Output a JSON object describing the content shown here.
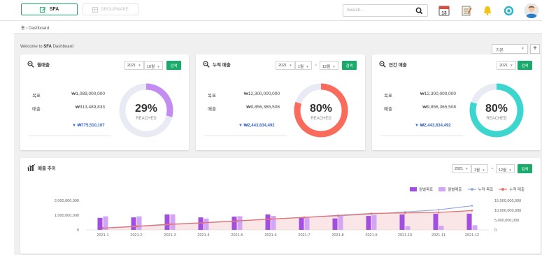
{
  "header": {
    "tab_sfa": "SFA",
    "tab_groupware": "GROUPWARE",
    "search_placeholder": "Search...",
    "calendar_day": "13",
    "breadcrumb": "Dashboard"
  },
  "welcome": {
    "prefix": "Welcome to ",
    "strong": "SFA",
    "suffix": " Dashboard"
  },
  "layout_select": "기본",
  "cards": [
    {
      "title": "월매출",
      "year": "2021",
      "month": "10월",
      "btn": "검색",
      "target_label": "목표",
      "target": "₩1,089,000,000",
      "sales_label": "매출",
      "sales": "₩313,489,833",
      "diff": "₩775,510,167",
      "percent": "29%",
      "reached": "REACHED",
      "progress": 0.29,
      "color": "#c28cf0"
    },
    {
      "title": "누적 매출",
      "year": "2021",
      "from": "1월",
      "to": "12월",
      "btn": "검색",
      "target_label": "목표",
      "target": "₩12,300,000,000",
      "sales_label": "매출",
      "sales": "₩9,856,365,508",
      "diff": "₩2,443,634,492",
      "percent": "80%",
      "reached": "REACHED",
      "progress": 0.8,
      "color": "#fa6b5b"
    },
    {
      "title": "연간 매출",
      "year": "2021",
      "btn": "검색",
      "target_label": "목표",
      "target": "₩12,300,000,000",
      "sales_label": "매출",
      "sales": "₩9,856,365,508",
      "diff": "₩2,443,634,492",
      "percent": "80%",
      "reached": "REACHED",
      "progress": 0.8,
      "color": "#3dd6cf"
    }
  ],
  "trend": {
    "title": "매출 추이",
    "year": "2021",
    "from": "1월",
    "to": "12월",
    "btn": "검색"
  },
  "colors": {
    "accent": "#1aab6c",
    "link": "#3d66cf",
    "bg": "#f0f0f0"
  },
  "chart_data": {
    "type": "bar",
    "categories": [
      "2021-1",
      "2021-2",
      "2021-3",
      "2021-4",
      "2021-5",
      "2021-6",
      "2021-7",
      "2021-8",
      "2021-9",
      "2021-10",
      "2021-11",
      "2021-12"
    ],
    "series": [
      {
        "name": "월별목표",
        "type": "bar",
        "axis": "left",
        "color": "#a24fe0",
        "values": [
          820000000,
          850000000,
          1050000000,
          850000000,
          900000000,
          1050000000,
          850000000,
          780000000,
          950000000,
          1050000000,
          1100000000,
          1100000000
        ]
      },
      {
        "name": "월별매출",
        "type": "bar",
        "axis": "left",
        "color": "#d2a6f5",
        "values": [
          920000000,
          920000000,
          1050000000,
          770000000,
          930000000,
          950000000,
          850000000,
          1000000000,
          1000000000,
          250000000,
          280000000,
          313489833
        ]
      },
      {
        "name": "누적 목표",
        "type": "line",
        "axis": "right",
        "color": "#9aaad8",
        "values": [
          820000000,
          1670000000,
          2720000000,
          3570000000,
          4470000000,
          5520000000,
          6370000000,
          7150000000,
          8100000000,
          9150000000,
          10250000000,
          12300000000
        ]
      },
      {
        "name": "누적 매출",
        "type": "line",
        "axis": "right",
        "color": "#ee6e6e",
        "values": [
          920000000,
          1840000000,
          2890000000,
          3660000000,
          4590000000,
          5540000000,
          6390000000,
          7390000000,
          8390000000,
          8640000000,
          8920000000,
          9856365508
        ]
      }
    ],
    "y_left": {
      "ticks": [
        "0",
        "1,000,000,000",
        "2,000,000,000"
      ],
      "ylim": [
        0,
        2000000000
      ]
    },
    "y_right": {
      "ticks": [
        "0",
        "5,000,000,000",
        "10,000,000,000",
        "15,000,000,000"
      ],
      "ylim": [
        0,
        15000000000
      ]
    },
    "legend_position": "top-right"
  }
}
